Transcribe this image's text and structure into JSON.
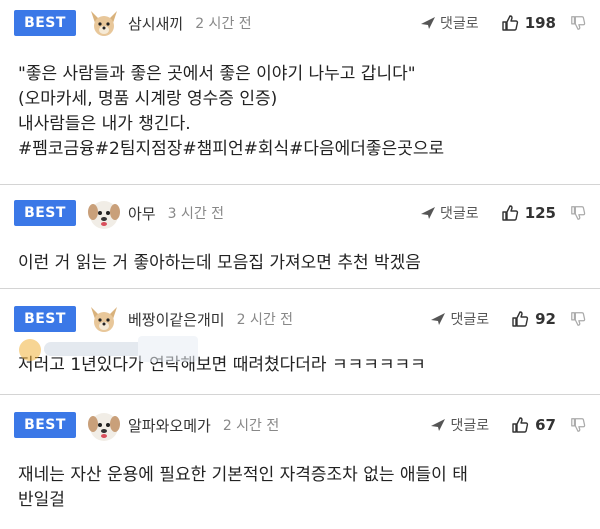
{
  "comments": [
    {
      "badge": "BEST",
      "username": "삼시새끼",
      "time": "2 시간 전",
      "reply_label": "댓글로",
      "likes": "198",
      "avatar_icon": "dog-avatar-icon",
      "text": "\"좋은 사람들과 좋은 곳에서 좋은 이야기 나누고 갑니다\"\n(오마카세, 명품 시계랑 영수증 인증)\n내사람들은 내가 챙긴다.\n#펨코금융#2팀지점장#챔피언#회식#다음에더좋은곳으로"
    },
    {
      "badge": "BEST",
      "username": "아무",
      "time": "3 시간 전",
      "reply_label": "댓글로",
      "likes": "125",
      "avatar_icon": "puppy-avatar-icon",
      "text": "이런 거 읽는 거 좋아하는데 모음집 가져오면 추천 박겠음"
    },
    {
      "badge": "BEST",
      "username": "베짱이같은개미",
      "time": "2 시간 전",
      "reply_label": "댓글로",
      "likes": "92",
      "avatar_icon": "dog-avatar-icon",
      "text": "저러고 1년있다가 연락해보면 때려쳤다더라 ㅋㅋㅋㅋㅋㅋ"
    },
    {
      "badge": "BEST",
      "username": "알파와오메가",
      "time": "2 시간 전",
      "reply_label": "댓글로",
      "likes": "67",
      "avatar_icon": "puppy-avatar-icon",
      "text": "재네는 자산 운용에 필요한 기본적인 자격증조차 없는 애들이 태\n반일걸"
    }
  ],
  "colors": {
    "badge": "#3b78e7",
    "divider": "#d4d4d4"
  }
}
